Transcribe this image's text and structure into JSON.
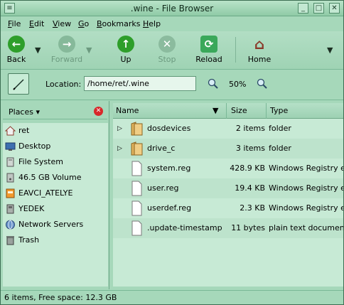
{
  "window": {
    "title": ".wine - File Browser"
  },
  "menu": [
    "File",
    "Edit",
    "View",
    "Go",
    "Bookmarks",
    "Help"
  ],
  "toolbar": {
    "back": "Back",
    "forward": "Forward",
    "up": "Up",
    "stop": "Stop",
    "reload": "Reload",
    "home": "Home"
  },
  "location": {
    "label": "Location:",
    "value": "/home/ret/.wine",
    "zoom": "50%"
  },
  "sidebar": {
    "header": "Places",
    "items": [
      {
        "label": "ret",
        "icon": "home-icon"
      },
      {
        "label": "Desktop",
        "icon": "desktop-icon"
      },
      {
        "label": "File System",
        "icon": "filesystem-icon"
      },
      {
        "label": "46.5 GB Volume",
        "icon": "drive-icon"
      },
      {
        "label": "EAVCI_ATELYE",
        "icon": "usb-drive-icon"
      },
      {
        "label": "YEDEK",
        "icon": "drive-icon"
      },
      {
        "label": "Network Servers",
        "icon": "network-icon"
      },
      {
        "label": "Trash",
        "icon": "trash-icon"
      }
    ]
  },
  "files": {
    "columns": [
      "Name",
      "Size",
      "Type"
    ],
    "rows": [
      {
        "name": "dosdevices",
        "size": "2 items",
        "type": "folder",
        "kind": "folder"
      },
      {
        "name": "drive_c",
        "size": "3 items",
        "type": "folder",
        "kind": "folder"
      },
      {
        "name": "system.reg",
        "size": "428.9 KB",
        "type": "Windows Registry ext",
        "kind": "file"
      },
      {
        "name": "user.reg",
        "size": "19.4 KB",
        "type": "Windows Registry ext",
        "kind": "file"
      },
      {
        "name": "userdef.reg",
        "size": "2.3 KB",
        "type": "Windows Registry ext",
        "kind": "file"
      },
      {
        "name": ".update-timestamp",
        "size": "11 bytes",
        "type": "plain text document",
        "kind": "file"
      }
    ]
  },
  "status": {
    "text": "6 items, Free space: 12.3 GB"
  }
}
